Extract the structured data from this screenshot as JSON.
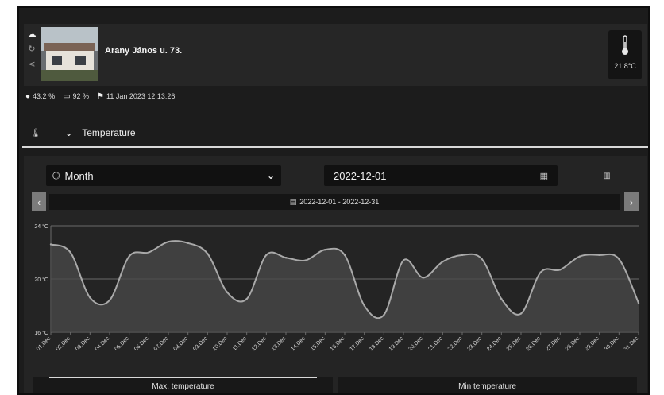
{
  "header": {
    "address": "Arany János u. 73.",
    "current_temperature": "21.8°C",
    "side_icons": [
      "cloud-icon",
      "refresh-icon",
      "share-icon"
    ]
  },
  "status": {
    "humidity": "43.2 %",
    "battery": "92 %",
    "last_update": "11 Jan 2023 12:13:26"
  },
  "sensor": {
    "label": "Temperature"
  },
  "controls": {
    "period": "Month",
    "date": "2022-12-01",
    "range": "2022-12-01 - 2022-12-31",
    "prev": "‹",
    "next": "›"
  },
  "tabs": [
    {
      "label": "Max. temperature"
    },
    {
      "label": "Min temperature"
    }
  ],
  "colors": {
    "line": "#a9a9a9",
    "area": "#4a4a4a",
    "grid": "#6a6a6a"
  },
  "chart_data": {
    "type": "area",
    "ylim": [
      16,
      24
    ],
    "yticks": [
      "16 °C",
      "20 °C",
      "24 °C"
    ],
    "x": [
      "01.Dec",
      "02.Dec",
      "03.Dec",
      "04.Dec",
      "05.Dec",
      "06.Dec",
      "07.Dec",
      "08.Dec",
      "09.Dec",
      "10.Dec",
      "11.Dec",
      "12.Dec",
      "13.Dec",
      "14.Dec",
      "15.Dec",
      "16.Dec",
      "17.Dec",
      "18.Dec",
      "19.Dec",
      "20.Dec",
      "21.Dec",
      "22.Dec",
      "23.Dec",
      "24.Dec",
      "25.Dec",
      "26.Dec",
      "27.Dec",
      "28.Dec",
      "29.Dec",
      "30.Dec",
      "31.Dec"
    ],
    "values": [
      22.6,
      22.0,
      18.6,
      18.4,
      21.7,
      22.0,
      22.8,
      22.7,
      21.9,
      19.0,
      18.5,
      21.8,
      21.6,
      21.4,
      22.2,
      21.8,
      18.0,
      17.3,
      21.4,
      20.1,
      21.3,
      21.8,
      21.5,
      18.5,
      17.4,
      20.5,
      20.7,
      21.7,
      21.8,
      21.5,
      18.2
    ]
  }
}
